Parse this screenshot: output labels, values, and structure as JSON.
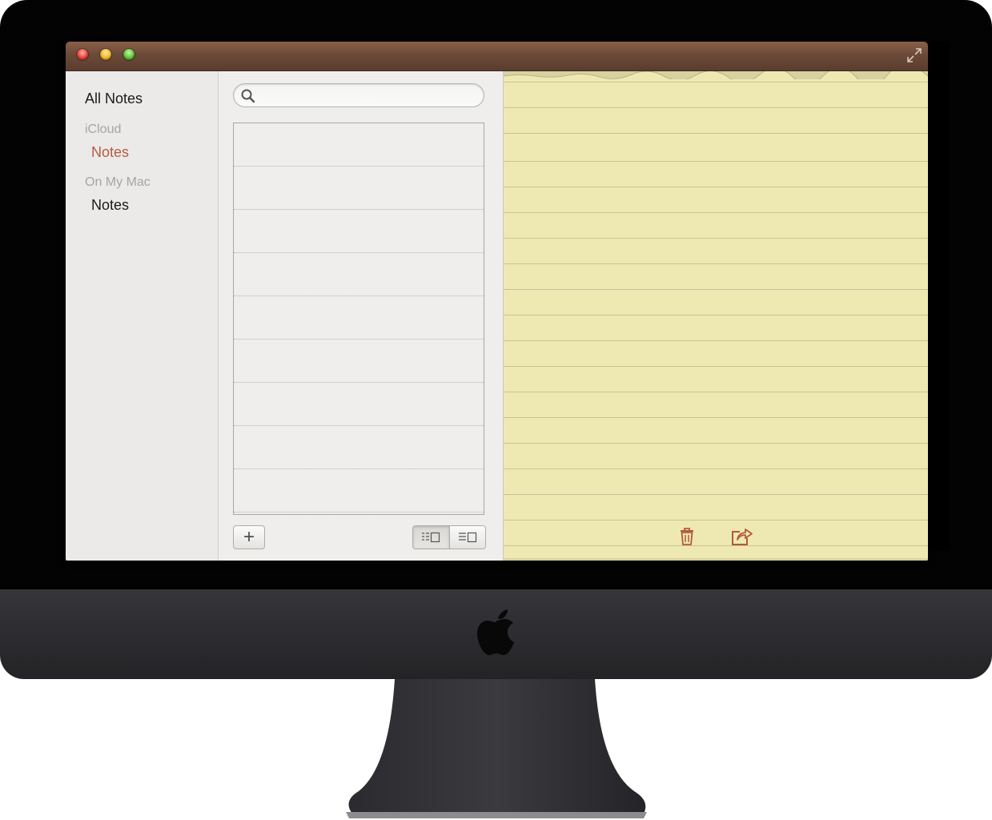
{
  "window": {
    "controls": {
      "close": "close-icon",
      "minimize": "minimize-icon",
      "zoom": "zoom-icon",
      "fullscreen": "fullscreen-icon"
    }
  },
  "sidebar": {
    "all_notes": "All Notes",
    "accounts": [
      {
        "header": "iCloud",
        "items": [
          {
            "label": "Notes",
            "selected": true
          }
        ]
      },
      {
        "header": "On My Mac",
        "items": [
          {
            "label": "Notes",
            "selected": false
          }
        ]
      }
    ]
  },
  "search": {
    "value": "",
    "placeholder": "",
    "icon": "search-icon"
  },
  "note_list": {
    "rows": [
      "",
      "",
      "",
      "",
      "",
      "",
      "",
      "",
      ""
    ]
  },
  "list_toolbar": {
    "add_label": "+",
    "view_modes": [
      "list-with-preview-icon",
      "list-only-icon"
    ],
    "active_view": 0
  },
  "note_toolbar": {
    "delete": "trash-icon",
    "share": "share-icon"
  },
  "colors": {
    "titlebar": "#6c4a38",
    "paper": "#eee9b2",
    "selected_folder": "#b65a44",
    "icon_accent": "#b4593c"
  }
}
